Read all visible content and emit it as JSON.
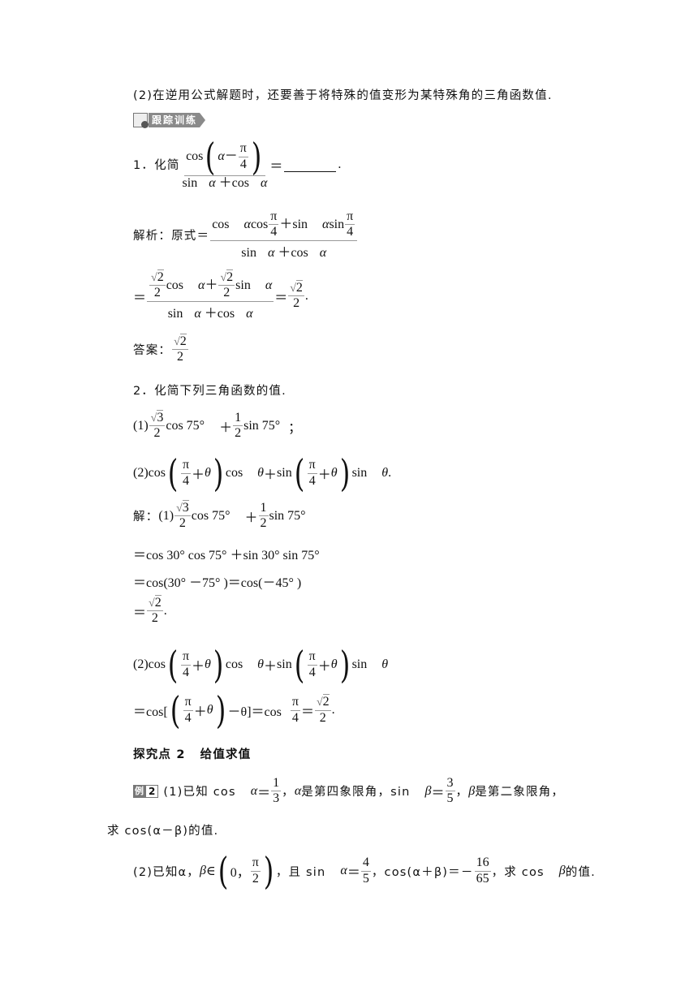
{
  "intro": {
    "note2": "(2)在逆用公式解题时，还要善于将特殊的值变形为某特殊角的三角函数值."
  },
  "tracking_badge": {
    "icon": "checklist-icon",
    "label": "跟踪训练"
  },
  "problem1": {
    "prefix": "1．化简",
    "numerator": "cos(α − π/4)",
    "denominator": "sin α + cos α",
    "suffix": "=________.",
    "solution_label": "解析：原式＝",
    "step1_numerator": "cos α cos π/4 + sin α sin π/4",
    "step1_denominator": "sin α + cos α",
    "step2": "= (√2/2 cos α + √2/2 sin α)/(sin α + cos α) = √2/2.",
    "answer_label": "答案：",
    "answer": "√2/2"
  },
  "problem2": {
    "title": "2．化简下列三角函数的值.",
    "part1": "(1)√3/2 cos 75° + 1/2 sin 75°；",
    "part2": "(2)cos(π/4 + θ)cos θ + sin(π/4 + θ)sin θ.",
    "solution_label": "解：",
    "sol1_lines": [
      "(1)√3/2 cos 75° + 1/2 sin 75°",
      "=cos 30° cos 75° + sin 30° sin 75°",
      "=cos(30° − 75°)=cos(−45°)",
      "=√2/2."
    ],
    "sol2_lines": [
      "(2)cos(π/4 + θ)cos θ + sin(π/4 + θ)sin θ",
      "=cos[(π/4 + θ) − θ]=cos π/4 = √2/2."
    ]
  },
  "section": {
    "title": "探究点 2　给值求值"
  },
  "example2": {
    "badge_a": "例",
    "badge_b": "2",
    "part1": "(1)已知 cos α = 1/3，α是第四象限角，sin β = 3/5，β是第二象限角，求 cos(α−β)的值.",
    "part2": "(2)已知α，β∈(0, π/2)，且 sin α = 4/5，cos(α+β) = −16/65，求 cos β的值."
  },
  "t": {
    "cos": "cos",
    "sin": "sin",
    "pi": "π",
    "four": "4",
    "two": "2",
    "three": "3",
    "one": "1",
    "five": "5",
    "alpha": "α",
    "beta": "β",
    "theta": "θ",
    "sqrt2": "2",
    "sqrt3": "3",
    "rad": "√",
    "eq": "＝",
    "plus": "＋",
    "minus": "－",
    "period": ".",
    "comma": "，",
    "semi": "；",
    "p1": "(1)",
    "p2": "(2)",
    "deg": "°",
    "p1_prefix": "1．化简",
    "sol_label": "解析：原式＝",
    "ans_label": "答案：",
    "p2_title": "2．化简下列三角函数的值.",
    "sol2_label": "解：",
    "cos75": "cos 75°",
    "sin75": "sin 75°",
    "line_cos30": "＝cos 30°  cos 75°  ＋sin 30°  sin 75°",
    "line_diff": "＝cos(30°  －75°  )＝cos(－45°  )",
    "sec_title": "探究点 2",
    "sec_title2": "给值求值",
    "ex_known1": "(1)已知 cos",
    "ex_q4": "是第四象限角，sin",
    "ex_q2": "是第二象限角，",
    "ex_ask1": "求 cos(α－β)的值.",
    "ex_known2": "(2)已知α，",
    "ex_in": "∈",
    "zero_comma": "0，",
    "ex_and": "，且 sin",
    "ex_cosab": "，cos(α＋β)＝－",
    "sixteen": "16",
    "sixtyfive": "65",
    "ex_ask2": "，求 cos",
    "ex_ask2b": "的值.",
    "cos_open_bracket": "＝cos[",
    "minus_theta_close": "－θ]＝cos"
  }
}
